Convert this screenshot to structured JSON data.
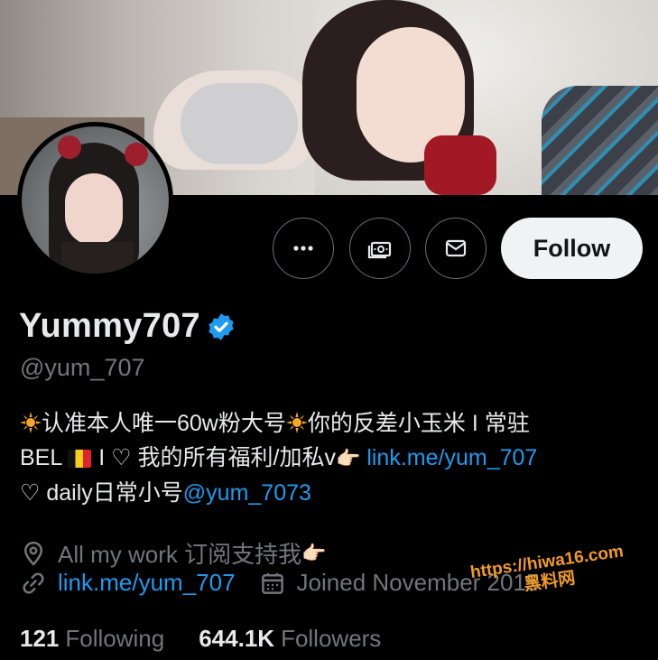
{
  "profile": {
    "display_name": "Yummy707",
    "handle": "@yum_707",
    "verified": true
  },
  "actions": {
    "more_icon": "more-horizontal-icon",
    "subscribe_icon": "subscribe-money-icon",
    "message_icon": "mail-icon",
    "follow_label": "Follow"
  },
  "bio": {
    "line1_a": "认准本人唯一60w粉大号",
    "line1_b": "你的反差小玉米 I 常驻",
    "line2_a": "BEL",
    "line2_b": "I ♡ 我的所有福利/加私v",
    "line2_hand": "👉🏻",
    "line2_link": "link.me/yum_707",
    "line3_a": "♡ daily日常小号",
    "line3_link": "@yum_7073"
  },
  "meta": {
    "location": "All my work 订阅支持我",
    "location_hand": "👉🏻",
    "website": "link.me/yum_707",
    "joined": "Joined November 2015"
  },
  "stats": {
    "following_count": "121",
    "following_label": "Following",
    "followers_count": "644.1K",
    "followers_label": "Followers"
  },
  "watermark": {
    "line1": "https://hiwa16.com",
    "line2": "黑料网"
  },
  "colors": {
    "background": "#000000",
    "link": "#1d9bf0",
    "muted": "#71767b",
    "verified": "#1d9bf0",
    "follow_bg": "#eff3f4"
  }
}
